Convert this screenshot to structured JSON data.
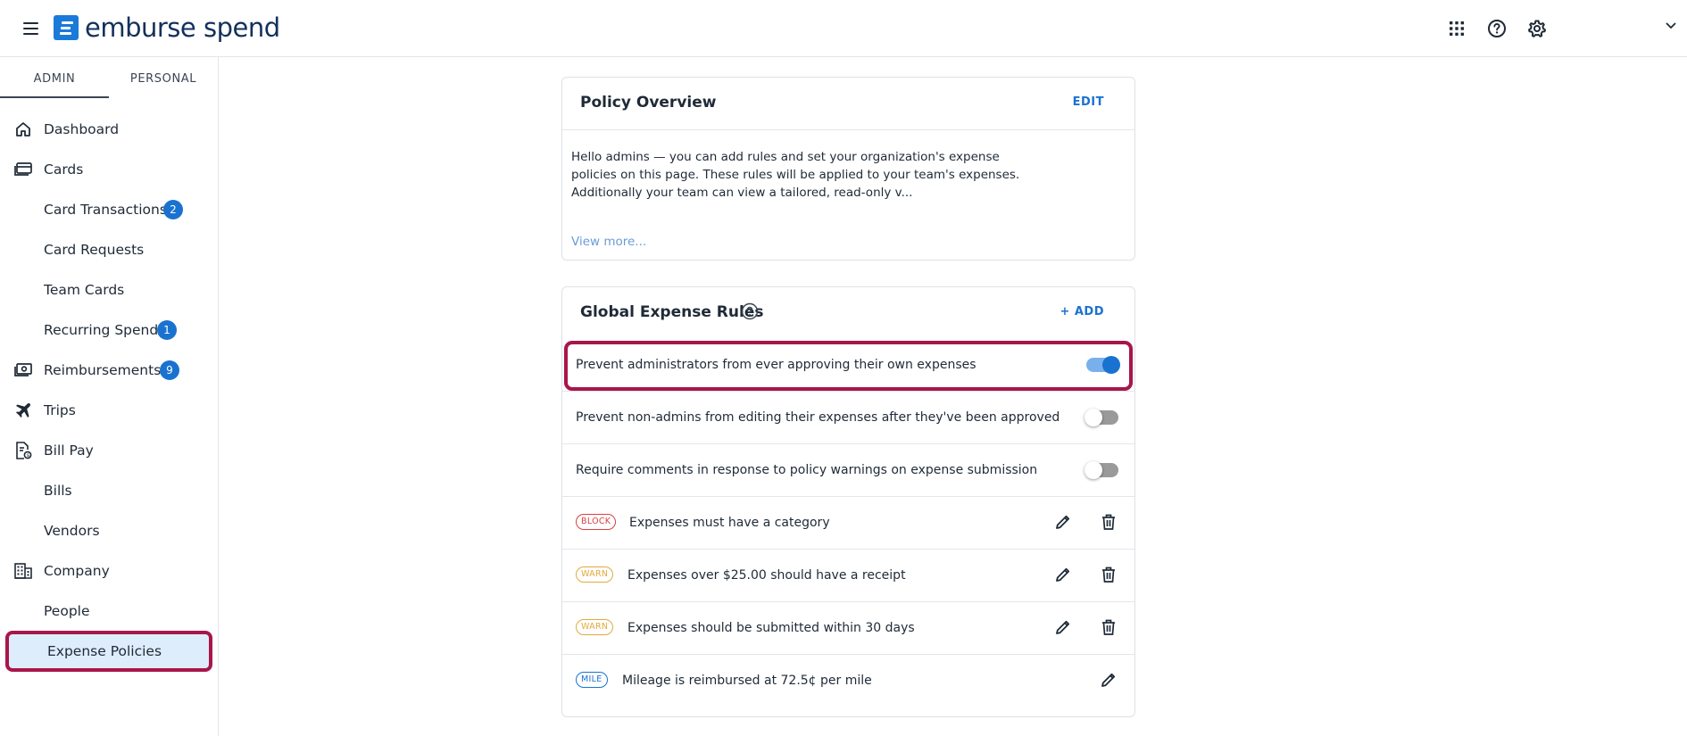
{
  "topbar": {
    "logo_text": "emburse spend",
    "icons": [
      "menu-icon",
      "apps-grid-icon",
      "help-icon",
      "settings-icon",
      "chevron-down-icon"
    ]
  },
  "sidebar": {
    "tabs": [
      {
        "label": "ADMIN",
        "active": true
      },
      {
        "label": "PERSONAL",
        "active": false
      }
    ],
    "items": [
      {
        "label": "Dashboard",
        "icon": "home-icon"
      },
      {
        "label": "Cards",
        "icon": "cards-icon"
      },
      {
        "label": "Card Transactions",
        "badge": "2"
      },
      {
        "label": "Card Requests"
      },
      {
        "label": "Team Cards"
      },
      {
        "label": "Recurring Spend",
        "badge": "1"
      },
      {
        "label": "Reimbursements",
        "icon": "cash-icon",
        "badge": "9"
      },
      {
        "label": "Trips",
        "icon": "plane-icon"
      },
      {
        "label": "Bill Pay",
        "icon": "bill-icon"
      },
      {
        "label": "Bills"
      },
      {
        "label": "Vendors"
      },
      {
        "label": "Company",
        "icon": "building-icon"
      },
      {
        "label": "People"
      },
      {
        "label": "Expense Policies",
        "selected": true
      }
    ]
  },
  "overview": {
    "title": "Policy Overview",
    "edit_label": "EDIT",
    "body": "Hello admins — you can add rules and set your organization's expense policies on this page. These rules will be applied to your team's expenses. Additionally your team can view a tailored, read-only v...",
    "view_more": "View more..."
  },
  "rules": {
    "title": "Global Expense Rules",
    "add_label": "+ ADD",
    "toggles": [
      {
        "text": "Prevent administrators from ever approving their own expenses",
        "on": true
      },
      {
        "text": "Prevent non-admins from editing their expenses after they've been approved",
        "on": false
      },
      {
        "text": "Require comments in response to policy warnings on expense submission",
        "on": false
      }
    ],
    "items": [
      {
        "tag": "BLOCK",
        "text": "Expenses must have a category"
      },
      {
        "tag": "WARN",
        "text": "Expenses over $25.00 should have a receipt"
      },
      {
        "tag": "WARN",
        "text": "Expenses should be submitted within 30 days"
      },
      {
        "tag": "MILE",
        "text": "Mileage is reimbursed at 72.5¢ per mile"
      }
    ]
  },
  "colors": {
    "accent": "#1a72d0",
    "highlight": "#a8164a",
    "selected_bg": "#deedfb",
    "block": "#d94040",
    "warn": "#e2a93b"
  }
}
